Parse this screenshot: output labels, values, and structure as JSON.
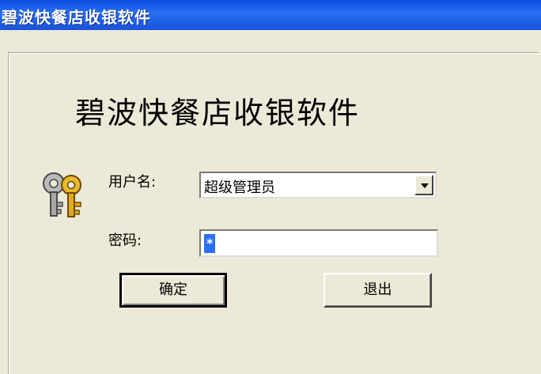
{
  "window": {
    "title": "碧波快餐店收银软件"
  },
  "login": {
    "heading": "碧波快餐店收银软件",
    "icon": "keys-icon",
    "username_label": "用户名:",
    "username_value": "超级管理员",
    "password_label": "密码:",
    "password_value": "*",
    "ok_label": "确定",
    "exit_label": "退出"
  },
  "colors": {
    "titlebar": "#2a70f5",
    "background": "#ece9d8",
    "selection": "#2a6ff5"
  }
}
